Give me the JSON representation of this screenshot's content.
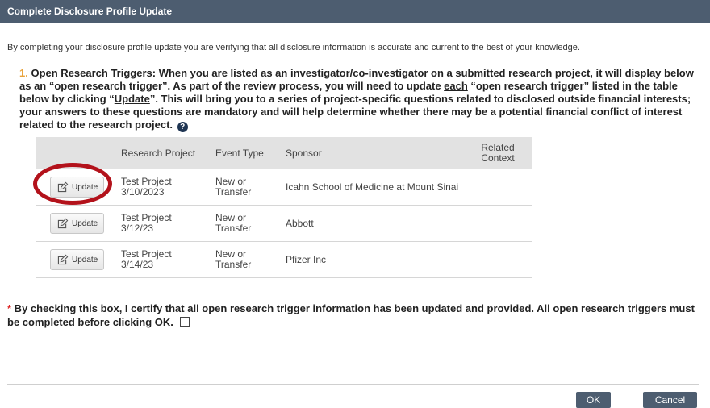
{
  "dialog": {
    "title": "Complete Disclosure Profile Update"
  },
  "intro": "By completing your disclosure profile update you are verifying that all disclosure information is accurate and current to the best of your knowledge.",
  "question": {
    "number": "1.",
    "text_part1": "Open Research Triggers: When you are listed as an investigator/co-investigator on a submitted research project, it will display below as an “open research trigger”. As part of the review process, you will need to update ",
    "emphasis_each": "each",
    "text_part2": " “open research trigger” listed in the table below by clicking “",
    "emphasis_update": "Update",
    "text_part3": "”. This will bring you to a series of project-specific questions related to disclosed outside financial interests; your answers to these questions are mandatory and will help determine whether there may be a potential financial conflict of interest related to the research project.",
    "help_icon": "question-circle-icon",
    "help_glyph": "?"
  },
  "table": {
    "headers": [
      "",
      "Research Project",
      "Event Type",
      "Sponsor",
      "Related Context"
    ],
    "update_label": "Update",
    "update_icon": "edit-icon",
    "rows": [
      {
        "project": "Test Project 3/10/2023",
        "event_type": "New or Transfer",
        "sponsor": "Icahn School of Medicine at Mount Sinai",
        "context": ""
      },
      {
        "project": "Test Project 3/12/23",
        "event_type": "New or Transfer",
        "sponsor": "Abbott",
        "context": ""
      },
      {
        "project": "Test Project 3/14/23",
        "event_type": "New or Transfer",
        "sponsor": "Pfizer Inc",
        "context": ""
      }
    ]
  },
  "certify": {
    "required_mark": "*",
    "text": " By checking this box, I certify that all open research trigger information has been updated and provided. All open research triggers must be completed before clicking OK."
  },
  "footer": {
    "ok_label": "OK",
    "cancel_label": "Cancel"
  },
  "colors": {
    "titlebar": "#4d5d70",
    "accent_number": "#e8a23a",
    "highlight_ring": "#b3121b",
    "required": "#dd2222"
  }
}
